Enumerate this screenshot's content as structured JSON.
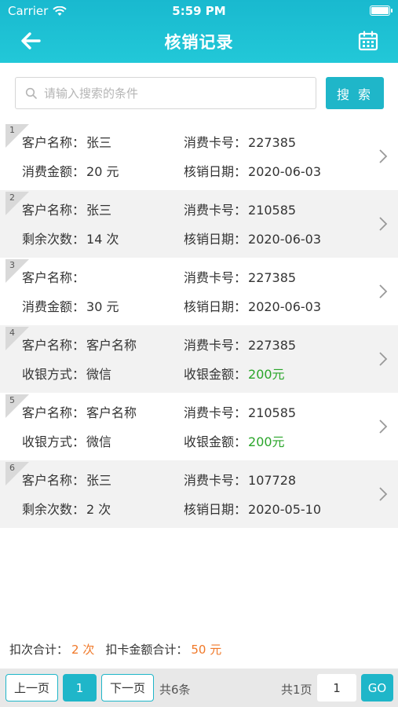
{
  "status_bar": {
    "carrier": "Carrier",
    "time": "5:59 PM"
  },
  "nav": {
    "title": "核销记录"
  },
  "search": {
    "placeholder": "请输入搜索的条件",
    "value": "",
    "button_label": "搜 索"
  },
  "records": [
    {
      "index": "1",
      "left1": {
        "label": "客户名称：",
        "value": "张三"
      },
      "right1": {
        "label": "消费卡号：",
        "value": "227385"
      },
      "left2": {
        "label": "消费金额：",
        "value": "20 元"
      },
      "right2": {
        "label": "核销日期：",
        "value": "2020-06-03"
      }
    },
    {
      "index": "2",
      "left1": {
        "label": "客户名称：",
        "value": "张三"
      },
      "right1": {
        "label": "消费卡号：",
        "value": "210585"
      },
      "left2": {
        "label": "剩余次数：",
        "value": "14 次"
      },
      "right2": {
        "label": "核销日期：",
        "value": "2020-06-03"
      }
    },
    {
      "index": "3",
      "left1": {
        "label": "客户名称：",
        "value": ""
      },
      "right1": {
        "label": "消费卡号：",
        "value": "227385"
      },
      "left2": {
        "label": "消费金额：",
        "value": "30 元"
      },
      "right2": {
        "label": "核销日期：",
        "value": "2020-06-03"
      }
    },
    {
      "index": "4",
      "left1": {
        "label": "客户名称：",
        "value": "客户名称"
      },
      "right1": {
        "label": "消费卡号：",
        "value": "227385"
      },
      "left2": {
        "label": "收银方式：",
        "value": "微信"
      },
      "right2": {
        "label": "收银金额：",
        "value": "200元"
      }
    },
    {
      "index": "5",
      "left1": {
        "label": "客户名称：",
        "value": "客户名称"
      },
      "right1": {
        "label": "消费卡号：",
        "value": "210585"
      },
      "left2": {
        "label": "收银方式：",
        "value": "微信"
      },
      "right2": {
        "label": "收银金额：",
        "value": "200元"
      }
    },
    {
      "index": "6",
      "left1": {
        "label": "客户名称：",
        "value": "张三"
      },
      "right1": {
        "label": "消费卡号：",
        "value": "107728"
      },
      "left2": {
        "label": "剩余次数：",
        "value": "2 次"
      },
      "right2": {
        "label": "核销日期：",
        "value": "2020-05-10"
      }
    }
  ],
  "summary": {
    "count_label": "扣次合计：",
    "count_value": "2 次",
    "amount_label": "扣卡金额合计：",
    "amount_value": "50 元"
  },
  "pagination": {
    "prev_label": "上一页",
    "current_page": "1",
    "next_label": "下一页",
    "total_records": "共6条",
    "total_pages": "共1页",
    "page_input_value": "1",
    "go_label": "GO"
  },
  "colors": {
    "primary": "#1fb6c9",
    "header_gradient_end": "#22c8d8",
    "green_amount": "#2aa52a",
    "orange_summary": "#f07828",
    "row_alt_bg": "#f2f2f2"
  },
  "icons": {
    "back": "arrow-left-icon",
    "calendar": "calendar-icon",
    "search": "search-icon",
    "chevron": "chevron-right-icon",
    "wifi": "wifi-icon",
    "battery": "battery-icon"
  }
}
